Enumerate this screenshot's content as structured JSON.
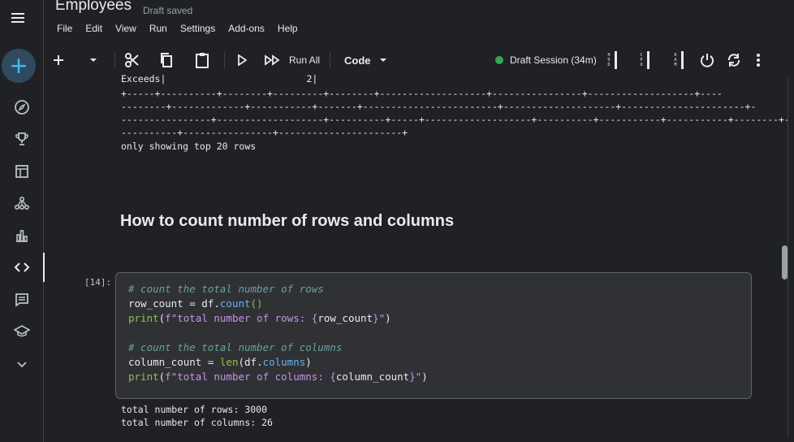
{
  "app": {
    "title": "Employees",
    "save_status": "Draft saved"
  },
  "menu": [
    "File",
    "Edit",
    "View",
    "Run",
    "Settings",
    "Add-ons",
    "Help"
  ],
  "rail_icons": [
    "menu-icon",
    "compass-icon",
    "trophy-icon",
    "table-icon",
    "network-icon",
    "bar-chart-icon",
    "code-icon",
    "comment-icon",
    "school-icon",
    "chevron-down-icon"
  ],
  "toolbar": {
    "run_all": "Run All",
    "cell_type": "Code",
    "session": "Draft Session (34m)",
    "meters": [
      "HDD",
      "CPU",
      "RAM"
    ]
  },
  "accent": "#41b4f5",
  "session_color": "#34a853",
  "output_top": {
    "exceeds_line": "Exceeds|                         2|",
    "border1": "+-----+----------+--------+---------+--------+-------------------+----------------+-------------------+----",
    "border2": "--------+-------------+-----------+-------+------------------------+--------------------+----------------------+-",
    "border3": "----------------+-------------------+----------+-----+-------------------+----------+-----------+-----------+--------+-",
    "border4": "----------+----------------+----------------------+",
    "footer": "only showing top 20 rows"
  },
  "heading": "How to count number of rows and columns",
  "cell": {
    "exec_count": "[14]:",
    "line1": "# count the total number of rows",
    "line2_var": "row_count",
    "line2_op": " = df.",
    "line2_fn": "count",
    "line2_paren": "()",
    "line3_fn": "print",
    "line3_a": "(",
    "line3_str": "f\"total number of rows: {",
    "line3_var": "row_count",
    "line3_str2": "}\"",
    "line3_end": ")",
    "line5": "# count the total number of columns",
    "line6_var": "column_count",
    "line6_op": " = ",
    "line6_fn": "len",
    "line6_b": "(df.",
    "line6_attr": "columns",
    "line6_end": ")",
    "line7_fn": "print",
    "line7_a": "(",
    "line7_str": "f\"total number of columns: {",
    "line7_var": "column_count",
    "line7_str2": "}\"",
    "line7_end": ")"
  },
  "result": {
    "rows": "total number of rows: 3000",
    "cols": "total number of columns: 26"
  }
}
